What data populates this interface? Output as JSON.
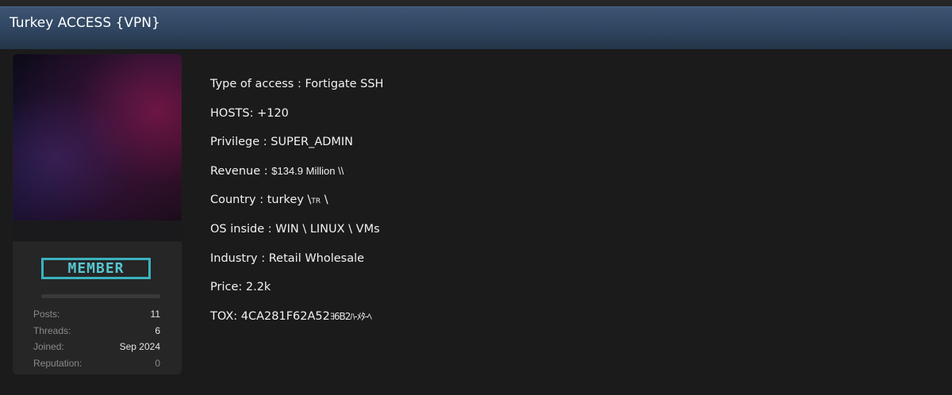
{
  "thread": {
    "title": "Turkey ACCESS {VPN}"
  },
  "user": {
    "rank": "MEMBER",
    "stats": [
      {
        "label": "Posts:",
        "value": "11"
      },
      {
        "label": "Threads:",
        "value": "6"
      },
      {
        "label": "Joined:",
        "value": "Sep 2024"
      },
      {
        "label": "Reputation:",
        "value": "0"
      }
    ]
  },
  "post": {
    "access_type": "Type of access : Fortigate SSH",
    "hosts": "HOSTS: +120",
    "privilege": "Privilege : SUPER_ADMIN",
    "revenue_label": "Revenue : ",
    "revenue_value": "$134.9 Million \\\\",
    "country_label": "Country : turkey \\",
    "country_flag": "TR",
    "country_end": " \\",
    "os": "OS inside : WIN \\ LINUX \\ VMs",
    "industry": "Industry : Retail Wholesale",
    "price": "Price: 2.2k",
    "tox_label": "TOX: 4CA281F62A52",
    "tox_redacted": "ﾖ6B2ﾊ-ﾒﾀ-ﾍ"
  },
  "colors": {
    "header": "#2f4560",
    "badge": "#3ab3bf",
    "panel": "#262626",
    "background": "#1b1b1b"
  }
}
